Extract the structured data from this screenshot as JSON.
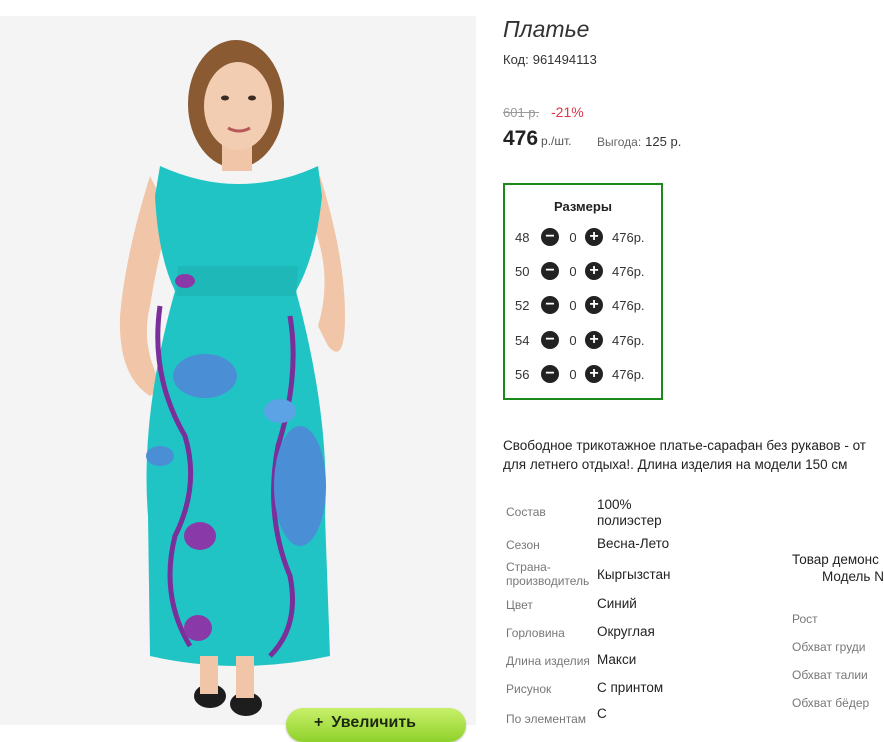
{
  "product": {
    "title": "Платье",
    "code_label": "Код:",
    "code_value": "961494113"
  },
  "price": {
    "old": "601 р.",
    "discount": "-21%",
    "current": "476",
    "unit": "р./шт.",
    "benefit_label": "Выгода:",
    "benefit_value": "125 р."
  },
  "sizes": {
    "title": "Размеры",
    "rows": [
      {
        "size": "48",
        "qty": "0",
        "price": "476р."
      },
      {
        "size": "50",
        "qty": "0",
        "price": "476р."
      },
      {
        "size": "52",
        "qty": "0",
        "price": "476р."
      },
      {
        "size": "54",
        "qty": "0",
        "price": "476р."
      },
      {
        "size": "56",
        "qty": "0",
        "price": "476р."
      }
    ]
  },
  "description": {
    "line1": "Свободное трикотажное платье-сарафан без рукавов - от",
    "line2": "для летнего отдыха!. Длина изделия на модели 150 см"
  },
  "specs": [
    {
      "label": "Состав",
      "value": "100% полиэстер"
    },
    {
      "label": "Сезон",
      "value": "Весна-Лето"
    },
    {
      "label": "Страна-производитель",
      "value": "Кыргызстан"
    },
    {
      "label": "Цвет",
      "value": "Синий"
    },
    {
      "label": "Горловина",
      "value": "Округлая"
    },
    {
      "label": "Длина изделия",
      "value": "Макси"
    },
    {
      "label": "Рисунок",
      "value": "С принтом"
    },
    {
      "label": "По элементам",
      "value": "С"
    }
  ],
  "model": {
    "title": "Товар демонс",
    "subtitle": "Модель N",
    "params": [
      "Рост",
      "Обхват груди",
      "Обхват талии",
      "Обхват бёдер"
    ]
  },
  "zoom_button": {
    "label": "Увеличить",
    "icon": "plus-icon"
  },
  "colors": {
    "border_green": "#1b8a1b",
    "discount_red": "#e0344a",
    "dress_turquoise": "#21c4c4",
    "button_green": "#8fd12b"
  }
}
